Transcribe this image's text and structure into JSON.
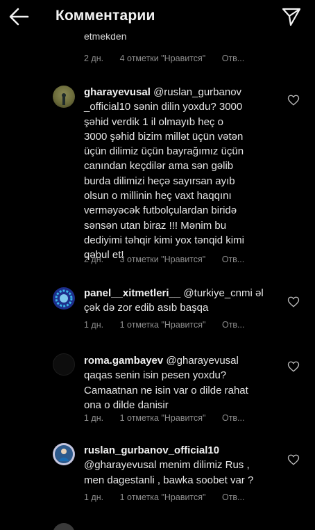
{
  "header": {
    "title": "Комментарии",
    "back_icon": "arrow-left-icon",
    "send_icon": "send-icon"
  },
  "partial_comment": {
    "text": "etmekden",
    "meta": {
      "time": "2 дн.",
      "likes": "4 отметки \"Нравится\"",
      "reply": "Отв..."
    }
  },
  "comments": [
    {
      "username": "gharayevusal",
      "lines": [
        [
          "@ruslan_gurbanov",
          ""
        ],
        [
          "_official10",
          " sənin dilin yoxdu? 3000"
        ],
        [
          "",
          "şəhid verdik 1 il olmayıb heç o"
        ],
        [
          "",
          "3000 şəhid bizim millət üçün vətən"
        ],
        [
          "",
          "üçün dilimiz üçün bayrağımız üçün"
        ],
        [
          "",
          "canından keçdilər ama sən gəlib"
        ],
        [
          "",
          "burda dilimizi heçə sayırsan ayıb"
        ],
        [
          "",
          "olsun o millinin heç vaxt haqqını"
        ],
        [
          "",
          "verməyəcək futbolçulardan biridə"
        ],
        [
          "",
          "sənsən utan biraz !!! Mənim bu"
        ],
        [
          "",
          "dediyimi təhqir kimi yox tənqid kimi"
        ],
        [
          "",
          "qəbul et!"
        ]
      ],
      "time": "2 дн.",
      "likes": "3 отметки \"Нравится\"",
      "reply": "Отв..."
    },
    {
      "username": "panel__xitmetleri__",
      "lines": [
        [
          "@turkiye_cnmi",
          " əl"
        ],
        [
          "",
          "çək də zor edib asıb başqa"
        ]
      ],
      "time": "1 дн.",
      "likes": "1 отметка \"Нравится\"",
      "reply": "Отв..."
    },
    {
      "username": "roma.gambayev",
      "lines": [
        [
          "@gharayevusal",
          ""
        ],
        [
          "",
          "qaqas senin isin pesen yoxdu?"
        ],
        [
          "",
          "Camaatnan ne isin var o dilde rahat"
        ],
        [
          "",
          "ona o dilde danisir"
        ]
      ],
      "time": "1 дн.",
      "likes": "1 отметка \"Нравится\"",
      "reply": "Отв..."
    },
    {
      "username": "ruslan_gurbanov_official10",
      "lines": [
        [
          "@gharayevusal",
          " menim dilimiz Rus ,"
        ],
        [
          "",
          "men dagestanli , bawka soobet var ?"
        ]
      ],
      "time": "1 дн.",
      "likes": "1 отметка \"Нравится\"",
      "reply": "Отв..."
    }
  ],
  "colors": {
    "background": "#000000",
    "text": "#e6e6e6",
    "meta": "#8e8e8e"
  }
}
